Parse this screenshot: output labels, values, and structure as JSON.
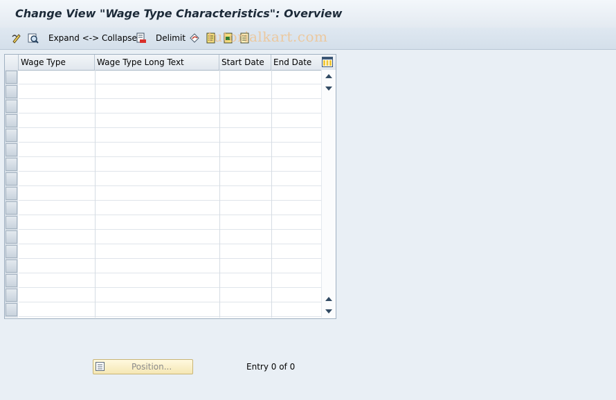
{
  "window": {
    "title": "Change View \"Wage Type Characteristics\": Overview"
  },
  "toolbar": {
    "expand_collapse_label": "Expand <-> Collapse",
    "delimit_label": "Delimit",
    "icons": [
      "change-display-icon",
      "details-icon",
      "delimit-icon",
      "undo-icon",
      "select-all-icon",
      "select-block-icon",
      "deselect-all-icon"
    ]
  },
  "watermark": {
    "text": "tutorialkart.com"
  },
  "table": {
    "columns": [
      "Wage Type",
      "Wage Type Long Text",
      "Start Date",
      "End Date"
    ],
    "row_count": 17,
    "rows": []
  },
  "footer": {
    "position_button_label": "Position...",
    "entry_text": "Entry 0 of 0"
  },
  "colors": {
    "background": "#e9eff5",
    "title_text": "#1c2a38",
    "watermark": "#f0c28c",
    "position_button": "#f5e7b4"
  }
}
